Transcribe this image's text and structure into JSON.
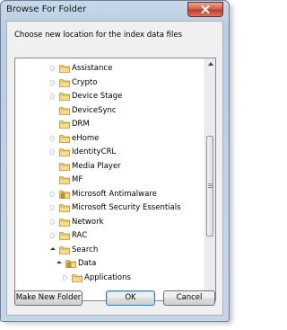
{
  "window": {
    "title": "Browse For Folder"
  },
  "dialog": {
    "description": "Choose new location for the index data files"
  },
  "tree": {
    "items": [
      {
        "label": "Assistance",
        "level": 0,
        "state": "collapsed",
        "locked": false
      },
      {
        "label": "Crypto",
        "level": 0,
        "state": "collapsed",
        "locked": false
      },
      {
        "label": "Device Stage",
        "level": 0,
        "state": "collapsed",
        "locked": false
      },
      {
        "label": "DeviceSync",
        "level": 0,
        "state": "none",
        "locked": false
      },
      {
        "label": "DRM",
        "level": 0,
        "state": "none",
        "locked": false
      },
      {
        "label": "eHome",
        "level": 0,
        "state": "collapsed",
        "locked": false
      },
      {
        "label": "IdentityCRL",
        "level": 0,
        "state": "collapsed",
        "locked": false
      },
      {
        "label": "Media Player",
        "level": 0,
        "state": "none",
        "locked": false
      },
      {
        "label": "MF",
        "level": 0,
        "state": "none",
        "locked": false
      },
      {
        "label": "Microsoft Antimalware",
        "level": 0,
        "state": "collapsed",
        "locked": true
      },
      {
        "label": "Microsoft Security Essentials",
        "level": 0,
        "state": "collapsed",
        "locked": false
      },
      {
        "label": "Network",
        "level": 0,
        "state": "collapsed",
        "locked": false
      },
      {
        "label": "RAC",
        "level": 0,
        "state": "collapsed",
        "locked": false
      },
      {
        "label": "Search",
        "level": 0,
        "state": "expanded",
        "locked": false
      },
      {
        "label": "Data",
        "level": 1,
        "state": "expanded",
        "locked": true
      },
      {
        "label": "Applications",
        "level": 2,
        "state": "collapsed",
        "locked": false
      }
    ]
  },
  "buttons": {
    "new_folder": "Make New Folder",
    "ok": "OK",
    "cancel": "Cancel"
  },
  "icons": {
    "folder": "folder-icon",
    "close": "close-icon"
  },
  "colors": {
    "title_bar": "#c8d8ea",
    "close_button": "#c8412b",
    "folder_yellow": "#f1cf6a",
    "lock_gold": "#c9a227",
    "default_button_border": "#3c7fb1"
  }
}
